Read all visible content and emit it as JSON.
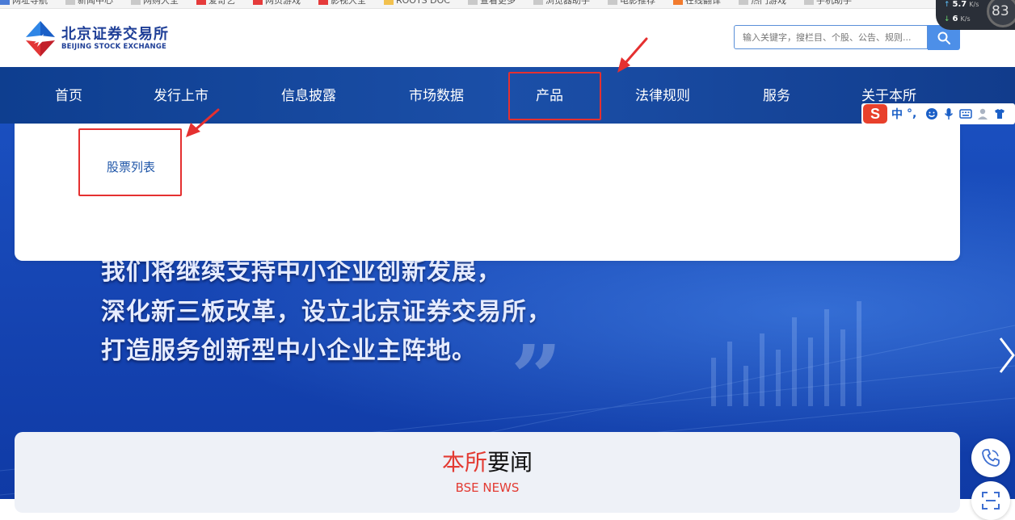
{
  "bookmarks": [
    {
      "label": "网址导航",
      "color": "#4a7bd6"
    },
    {
      "label": "新闻中心",
      "color": "#c9c9c9"
    },
    {
      "label": "网购大全",
      "color": "#c9c9c9"
    },
    {
      "label": "爱奇艺",
      "color": "#e53b3b"
    },
    {
      "label": "网页游戏",
      "color": "#e53b3b"
    },
    {
      "label": "影视大全",
      "color": "#e53b3b"
    },
    {
      "label": "ROOTS DOC",
      "color": "#f2c14e"
    },
    {
      "label": "查看更多",
      "color": "#c9c9c9"
    },
    {
      "label": "浏览器助手",
      "color": "#c9c9c9"
    },
    {
      "label": "电影推荐",
      "color": "#c9c9c9"
    },
    {
      "label": "在线翻译",
      "color": "#f27b2e"
    },
    {
      "label": "热门游戏",
      "color": "#c9c9c9"
    },
    {
      "label": "手机助手",
      "color": "#c9c9c9"
    }
  ],
  "logo": {
    "name_cn": "北京证券交易所",
    "name_en": "BEIJING STOCK EXCHANGE"
  },
  "search": {
    "placeholder": "输入关键字，搜栏目、个股、公告、规则..."
  },
  "network": {
    "upload": "5.7",
    "upload_unit": "K/s",
    "download": "6",
    "download_unit": "K/s",
    "percent": "83"
  },
  "nav": {
    "items": [
      "首页",
      "发行上市",
      "信息披露",
      "市场数据",
      "产品",
      "法律规则",
      "服务",
      "关于本所"
    ],
    "active_index": 4
  },
  "dropdown": {
    "items": [
      "股票列表"
    ]
  },
  "hero": {
    "lines": [
      "我们将继续支持中小企业创新发展，",
      "深化新三板改革，设立北京证券交易所，",
      "打造服务创新型中小企业主阵地。"
    ]
  },
  "news": {
    "title_red": "本所",
    "title_black": "要闻",
    "subtitle": "BSE NEWS"
  },
  "ime": {
    "logo": "S",
    "lang": "中",
    "punct": "°,"
  },
  "colors": {
    "nav_bg": "#1b4fa8",
    "brand": "#1f3f97",
    "annotation": "#e53030",
    "accent_red": "#e33b33",
    "search_button": "#4d8fe8"
  }
}
